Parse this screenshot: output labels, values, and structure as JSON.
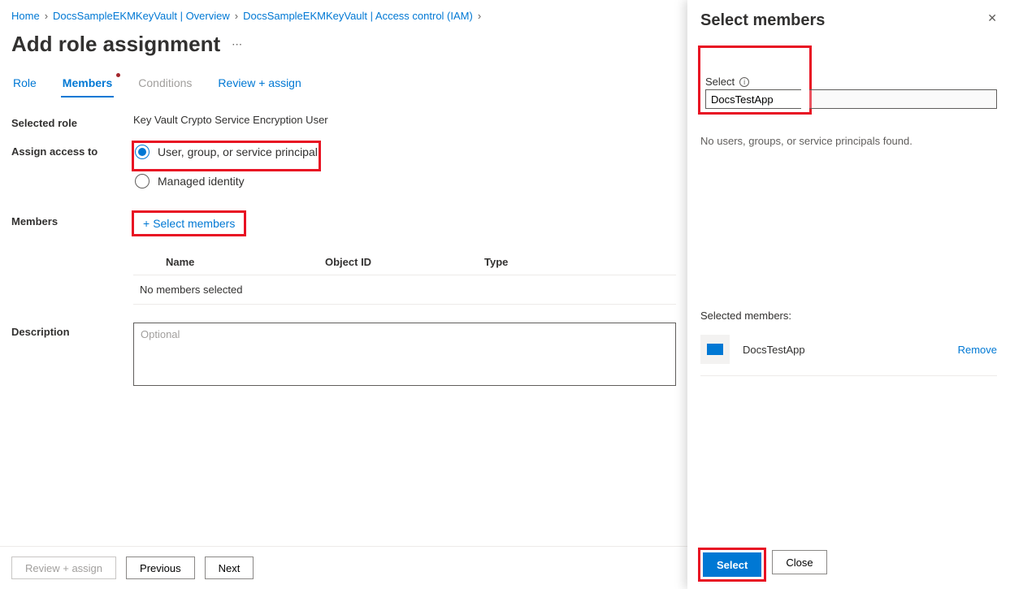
{
  "breadcrumbs": {
    "home": "Home",
    "overview": "DocsSampleEKMKeyVault | Overview",
    "iam": "DocsSampleEKMKeyVault | Access control (IAM)"
  },
  "page": {
    "title": "Add role assignment"
  },
  "tabs": {
    "role": "Role",
    "members": "Members",
    "conditions": "Conditions",
    "review": "Review + assign"
  },
  "form": {
    "selected_role_label": "Selected role",
    "selected_role_value": "Key Vault Crypto Service Encryption User",
    "assign_label": "Assign access to",
    "assign_option_user": "User, group, or service principal",
    "assign_option_managed": "Managed identity",
    "members_label": "Members",
    "select_members_link": "Select members",
    "description_label": "Description",
    "description_placeholder": "Optional"
  },
  "members_table": {
    "name_header": "Name",
    "object_header": "Object ID",
    "type_header": "Type",
    "empty_text": "No members selected"
  },
  "footer": {
    "review": "Review + assign",
    "previous": "Previous",
    "next": "Next"
  },
  "panel": {
    "title": "Select members",
    "select_label": "Select",
    "search_value": "DocsTestApp",
    "no_results": "No users, groups, or service principals found.",
    "selected_title": "Selected members:",
    "selected_member_name": "DocsTestApp",
    "remove_label": "Remove",
    "select_button": "Select",
    "close_button": "Close"
  }
}
